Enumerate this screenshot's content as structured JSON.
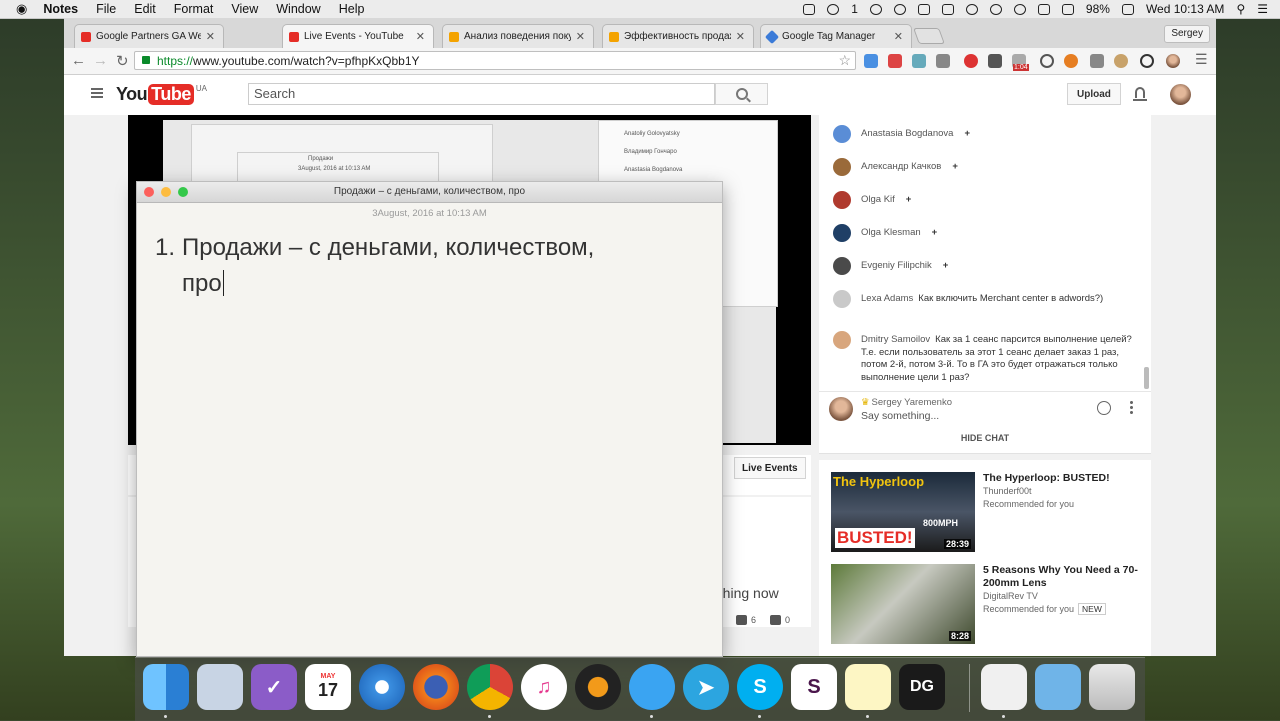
{
  "menubar": {
    "apple": "",
    "app_name": "Notes",
    "menus": [
      "File",
      "Edit",
      "Format",
      "View",
      "Window",
      "Help"
    ],
    "battery": "98%",
    "datetime": "Wed 10:13 AM",
    "notif_count": "1"
  },
  "browser": {
    "tabs": [
      {
        "label": "Google Partners GA Webinar",
        "favicon_color": "#e52d27"
      },
      {
        "label": "Live Events - YouTube",
        "favicon_color": "#e52d27"
      },
      {
        "label": "Анализ поведения покупат",
        "favicon_color": "#f4a300"
      },
      {
        "label": "Эффективность продаж –",
        "favicon_color": "#f4a300"
      },
      {
        "label": "Google Tag Manager",
        "favicon_color": "#3b7bd8"
      }
    ],
    "profile": "Sergey",
    "url_scheme": "https://",
    "url_rest": "www.youtube.com/watch?v=pfhpKxQbb1Y",
    "ext_badge": "1:04"
  },
  "youtube": {
    "logo_you": "You",
    "logo_tube": "Tube",
    "logo_country": "UA",
    "search_placeholder": "Search",
    "upload_label": "Upload",
    "live_events_label": "Live Events",
    "watching_now": "atching now",
    "likes": "6",
    "dislikes": "0",
    "shared_screen": {
      "names": [
        "Anatoliy Golovyatsky",
        "Владимир Гончаро",
        "Anastasia Bogdanova"
      ],
      "notes_title": "Продажи",
      "notes_date": "3August, 2016 at 10:13 AM"
    }
  },
  "chat": {
    "messages": [
      {
        "name": "Anastasia Bogdanova",
        "text": "",
        "plus": "+",
        "avatar_color": "#5a8dd6"
      },
      {
        "name": "Александр Качков",
        "text": "",
        "plus": "+",
        "avatar_color": "#9a6a3a"
      },
      {
        "name": "Olga Kif",
        "text": "",
        "plus": "+",
        "avatar_color": "#b03a2e"
      },
      {
        "name": "Olga Klesman",
        "text": "",
        "plus": "+",
        "avatar_color": "#1f3f66"
      },
      {
        "name": "Evgeniy Filipchik",
        "text": "",
        "plus": "+",
        "avatar_color": "#4a4a4a"
      },
      {
        "name": "Lexa Adams",
        "text": "Как включить Merchant center в adwords?)",
        "plus": "",
        "avatar_color": "#c9c9c9"
      },
      {
        "name": "Dmitry Samoilov",
        "text": "Как за 1 сеанс парсится выполнение целей? Т.е. если пользователь за этот 1 сеанс делает заказ 1 раз, потом 2-й, потом 3-й. То в ГА это будет отражаться только выполнение цели 1 раз?",
        "plus": "",
        "avatar_color": "#d8a67d"
      }
    ],
    "input_user": "Sergey Yaremenko",
    "input_placeholder": "Say something...",
    "hide_chat": "HIDE CHAT"
  },
  "recommendations": [
    {
      "title": "The Hyperloop: BUSTED!",
      "channel": "Thunderf00t",
      "meta": "Recommended for you",
      "badge": "",
      "duration": "28:39",
      "thumb_top": "The Hyperloop",
      "thumb_mid": "800MPH",
      "thumb_bottom": "BUSTED!"
    },
    {
      "title": "5 Reasons Why You Need a 70-200mm Lens",
      "channel": "DigitalRev TV",
      "meta": "Recommended for you",
      "badge": "NEW",
      "duration": "8:28"
    }
  ],
  "notes": {
    "window_title": "Продажи – с деньгами, количеством, про",
    "date": "3August, 2016 at 10:13 AM",
    "list_number": "1.",
    "line1": "Продажи – с деньгами, количеством,",
    "line2": "про"
  },
  "dock": {
    "calendar_month": "MAY",
    "calendar_day": "17",
    "items": [
      "Finder",
      "Preview",
      "OmniFocus",
      "Calendar",
      "Safari",
      "Firefox",
      "Chrome",
      "iTunes",
      "Speaker",
      "Messages",
      "Telegram",
      "Skype",
      "Slack",
      "TextEdit",
      "DataGrip",
      "Document",
      "Folder",
      "Trash"
    ]
  }
}
